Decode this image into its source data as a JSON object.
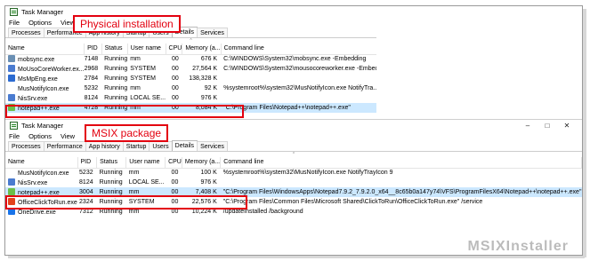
{
  "top_window": {
    "title": "Task Manager",
    "menu": [
      "File",
      "Options",
      "View"
    ],
    "tabs": [
      "Processes",
      "Performance",
      "App history",
      "Startup",
      "Users",
      "Details",
      "Services"
    ],
    "active_tab": "Details",
    "columns": [
      "Name",
      "PID",
      "Status",
      "User name",
      "CPU",
      "Memory (a...",
      "Command line"
    ],
    "rows": [
      {
        "icon": "gear-icon",
        "name": "mobsync.exe",
        "pid": "7148",
        "status": "Running",
        "user": "mm",
        "cpu": "00",
        "mem": "676 K",
        "cmd": "C:\\WINDOWS\\System32\\mobsync.exe -Embedding"
      },
      {
        "icon": "app-icon",
        "name": "MoUsoCoreWorker.ex...",
        "pid": "2968",
        "status": "Running",
        "user": "SYSTEM",
        "cpu": "00",
        "mem": "27,564 K",
        "cmd": "C:\\WINDOWS\\System32\\mousocoreworker.exe -Embedding"
      },
      {
        "icon": "shield-icon",
        "name": "MsMpEng.exe",
        "pid": "2784",
        "status": "Running",
        "user": "SYSTEM",
        "cpu": "00",
        "mem": "138,328 K",
        "cmd": ""
      },
      {
        "icon": "",
        "name": "MusNotifyIcon.exe",
        "pid": "5232",
        "status": "Running",
        "user": "mm",
        "cpu": "00",
        "mem": "92 K",
        "cmd": "%systemroot%\\system32\\MusNotifyIcon.exe NotifyTra..."
      },
      {
        "icon": "app-icon",
        "name": "NisSrv.exe",
        "pid": "8124",
        "status": "Running",
        "user": "LOCAL SE...",
        "cpu": "00",
        "mem": "976 K",
        "cmd": ""
      },
      {
        "icon": "notepad-icon",
        "name": "notepad++.exe",
        "pid": "4728",
        "status": "Running",
        "user": "mm",
        "cpu": "00",
        "mem": "8,084 K",
        "cmd": "\"C:\\Program Files\\Notepad++\\notepad++.exe\"",
        "selected": true
      }
    ],
    "label": "Physical installation"
  },
  "bottom_window": {
    "title": "Task Manager",
    "menu": [
      "File",
      "Options",
      "View"
    ],
    "tabs": [
      "Processes",
      "Performance",
      "App history",
      "Startup",
      "Users",
      "Details",
      "Services"
    ],
    "active_tab": "Details",
    "controls": [
      "–",
      "□",
      "✕"
    ],
    "columns": [
      "Name",
      "PID",
      "Status",
      "User name",
      "CPU",
      "Memory (a...",
      "Command line"
    ],
    "rows": [
      {
        "icon": "",
        "name": "MusNotifyIcon.exe",
        "pid": "5232",
        "status": "Running",
        "user": "mm",
        "cpu": "00",
        "mem": "100 K",
        "cmd": "%systemroot%\\system32\\MusNotifyIcon.exe NotifyTrayIcon 9"
      },
      {
        "icon": "app-icon",
        "name": "NisSrv.exe",
        "pid": "8124",
        "status": "Running",
        "user": "LOCAL SE...",
        "cpu": "00",
        "mem": "976 K",
        "cmd": ""
      },
      {
        "icon": "notepad-icon",
        "name": "notepad++.exe",
        "pid": "3004",
        "status": "Running",
        "user": "mm",
        "cpu": "00",
        "mem": "7,408 K",
        "cmd": "\"C:\\Program Files\\WindowsApps\\Notepad7.9.2_7.9.2.0_x64__8c65b0a147y74\\VFS\\ProgramFilesX64\\Notepad++\\notepad++.exe\"",
        "selected": true
      },
      {
        "icon": "office-icon",
        "name": "OfficeClickToRun.exe",
        "pid": "2324",
        "status": "Running",
        "user": "SYSTEM",
        "cpu": "00",
        "mem": "22,576 K",
        "cmd": "\"C:\\Program Files\\Common Files\\Microsoft Shared\\ClickToRun\\OfficeClickToRun.exe\" /service"
      },
      {
        "icon": "onedrive-icon",
        "name": "OneDrive.exe",
        "pid": "7312",
        "status": "Running",
        "user": "mm",
        "cpu": "00",
        "mem": "10,224 K",
        "cmd": "/updateInstalled /background"
      }
    ],
    "label": "MSIX package"
  },
  "watermark": "MSIXInstaller",
  "colors": {
    "highlight": "#e3000f",
    "selection": "#cce8ff"
  }
}
